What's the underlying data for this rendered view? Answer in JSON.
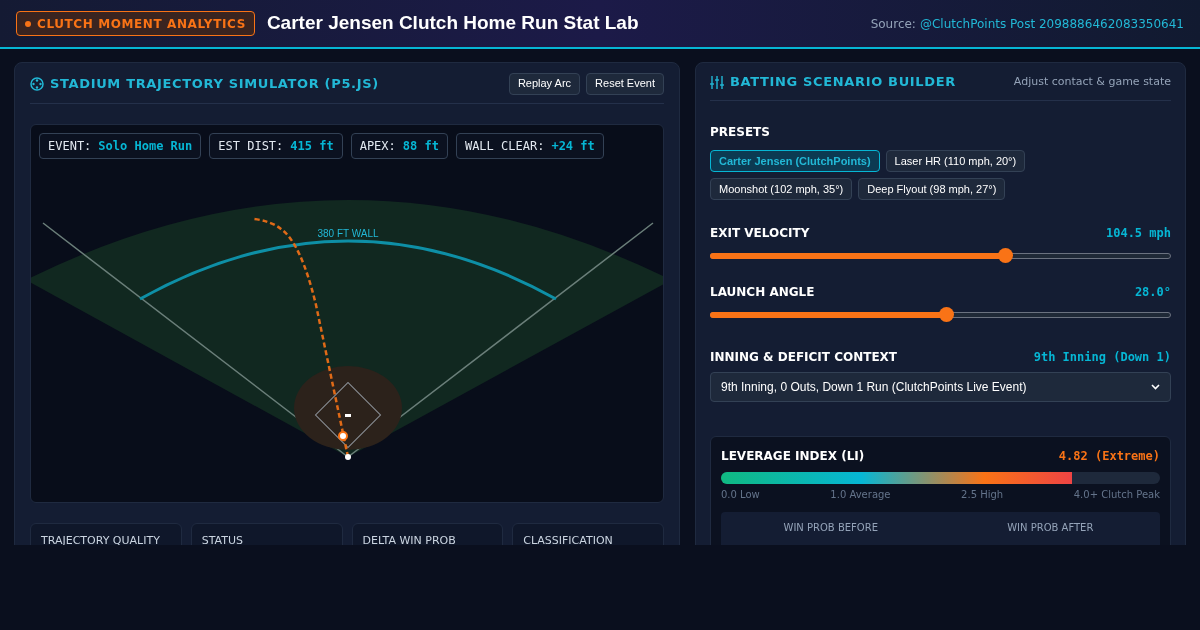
{
  "header": {
    "badge": "CLUTCH MOMENT ANALYTICS",
    "title": "Carter Jensen Clutch Home Run Stat Lab",
    "source_label": "Source:",
    "source_link": "@ClutchPoints Post 2098886462083350641"
  },
  "simulator": {
    "title": "STADIUM TRAJECTORY SIMULATOR (P5.JS)",
    "buttons": [
      "Replay Arc",
      "Reset Event"
    ],
    "stats": [
      {
        "label": "EVENT:",
        "value": "Solo Home Run"
      },
      {
        "label": "EST DIST:",
        "value": "415 ft"
      },
      {
        "label": "APEX:",
        "value": "88 ft"
      },
      {
        "label": "WALL CLEAR:",
        "value": "+24 ft"
      }
    ],
    "wall_label": "380 FT WALL",
    "metric_cards": [
      "TRAJECTORY QUALITY",
      "STATUS",
      "DELTA WIN PROB",
      "CLASSIFICATION"
    ]
  },
  "builder": {
    "title": "BATTING SCENARIO BUILDER",
    "subtitle": "Adjust contact & game state",
    "presets_label": "PRESETS",
    "presets": [
      {
        "label": "Carter Jensen (ClutchPoints)",
        "selected": true
      },
      {
        "label": "Laser HR (110 mph, 20°)",
        "selected": false
      },
      {
        "label": "Moonshot (102 mph, 35°)",
        "selected": false
      },
      {
        "label": "Deep Flyout (98 mph, 27°)",
        "selected": false
      }
    ],
    "sliders": [
      {
        "label": "EXIT VELOCITY",
        "reading": "104.5 mph",
        "level": 0.64
      },
      {
        "label": "LAUNCH ANGLE",
        "reading": "28.0°",
        "level": 0.513
      }
    ],
    "context": {
      "label": "INNING & DEFICIT CONTEXT",
      "reading": "9th Inning (Down 1)",
      "value": "9th Inning, 0 Outs, Down 1 Run (ClutchPoints Live Event)"
    },
    "leverage": {
      "title": "LEVERAGE INDEX (LI)",
      "reading": "4.82 (Extreme)",
      "level": 0.8,
      "scale": [
        "0.0 Low",
        "1.0 Average",
        "2.5 High",
        "4.0+ Clutch Peak"
      ],
      "win_prob": [
        "WIN PROB BEFORE",
        "WIN PROB AFTER"
      ]
    }
  }
}
